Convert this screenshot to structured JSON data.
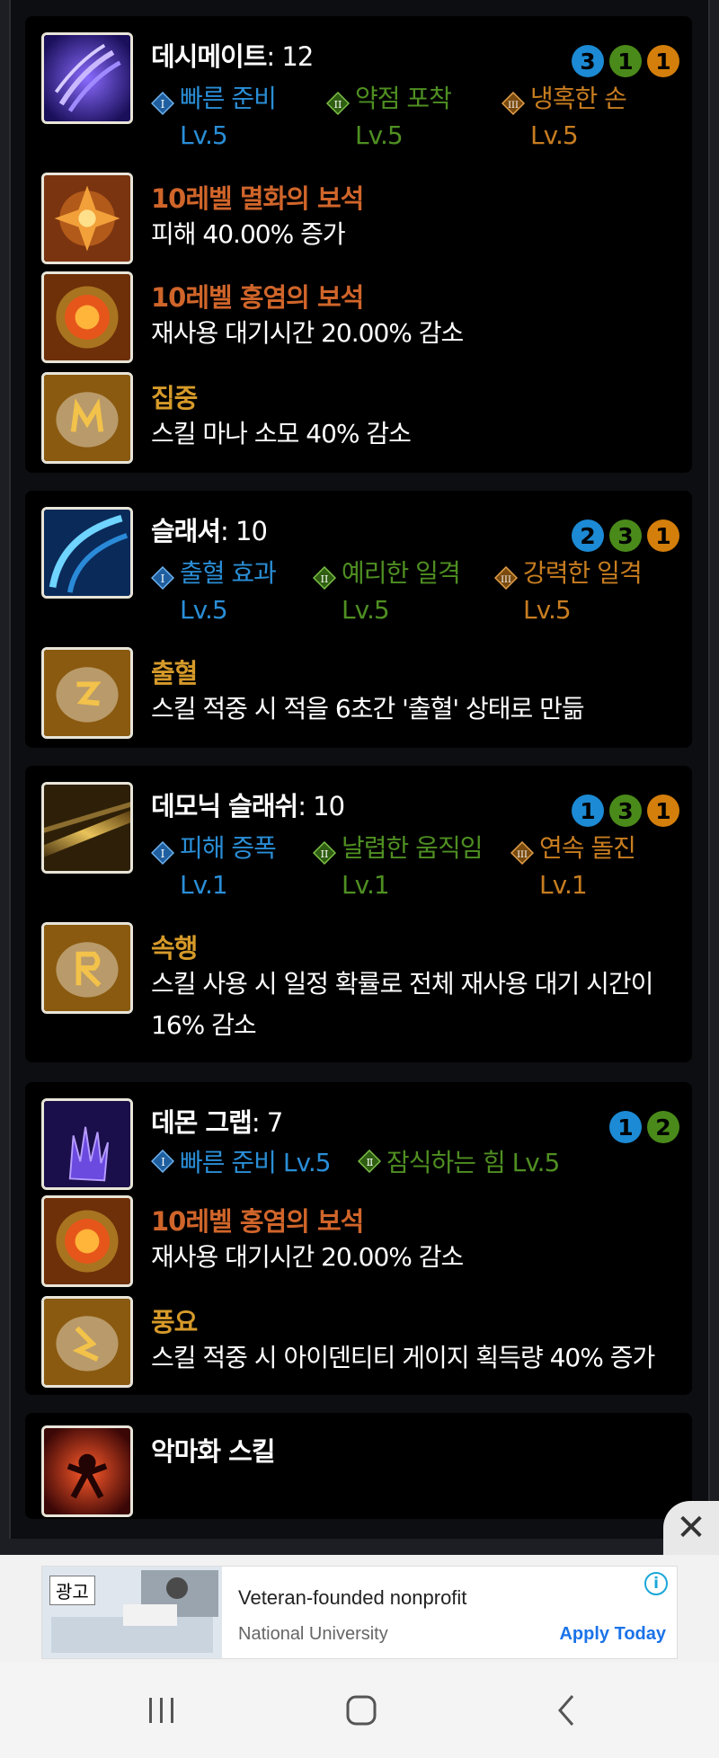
{
  "skills": [
    {
      "name": "데시메이트",
      "level": ": 12",
      "dots": [
        "3",
        "1",
        "1"
      ],
      "tripods": [
        {
          "name": "빠른 준비",
          "lv": "Lv.5"
        },
        {
          "name": "약점 포착",
          "lv": "Lv.5"
        },
        {
          "name": "냉혹한 손",
          "lv": "Lv.5"
        }
      ],
      "gems": [
        {
          "title": "10레벨 멸화의 보석",
          "desc": "피해 40.00% 증가"
        },
        {
          "title": "10레벨 홍염의 보석",
          "desc": "재사용 대기시간 20.00% 감소"
        }
      ],
      "rune": {
        "title": "집중",
        "desc": "스킬 마나 소모 40% 감소"
      }
    },
    {
      "name": "슬래셔",
      "level": ": 10",
      "dots": [
        "2",
        "3",
        "1"
      ],
      "tripods": [
        {
          "name": "출혈 효과",
          "lv": "Lv.5"
        },
        {
          "name": "예리한 일격",
          "lv": "Lv.5"
        },
        {
          "name": "강력한 일격",
          "lv": "Lv.5"
        }
      ],
      "rune": {
        "title": "출혈",
        "desc": "스킬 적중 시 적을 6초간 '출혈' 상태로 만듦"
      }
    },
    {
      "name": "데모닉 슬래쉬",
      "level": ": 10",
      "dots": [
        "1",
        "3",
        "1"
      ],
      "tripods": [
        {
          "name": "피해 증폭",
          "lv": "Lv.1"
        },
        {
          "name": "날렵한 움직임",
          "lv": "Lv.1"
        },
        {
          "name": "연속 돌진",
          "lv": "Lv.1"
        }
      ],
      "rune": {
        "title": "속행",
        "desc_line1": "스킬 사용 시 일정 확률로 전체 재사용 대기 시간이",
        "desc_line2": "16% 감소"
      }
    },
    {
      "name": "데몬 그랩",
      "level": ": 7",
      "dots": [
        "1",
        "2"
      ],
      "tripods": [
        {
          "name": "빠른 준비 Lv.5"
        },
        {
          "name": "잠식하는 힘 Lv.5"
        }
      ],
      "gems": [
        {
          "title": "10레벨 홍염의 보석",
          "desc": "재사용 대기시간 20.00% 감소"
        }
      ],
      "rune": {
        "title": "풍요",
        "desc": "스킬 적중 시 아이덴티티 게이지 획득량 40% 증가"
      }
    },
    {
      "name": "악마화 스킬"
    }
  ],
  "ad": {
    "badge": "광고",
    "title": "Veteran-founded nonprofit",
    "sponsor": "National University",
    "cta": "Apply Today",
    "info_glyph": "i"
  },
  "close_glyph": "✕",
  "colors": {
    "tripod_1": "#2a8ed6",
    "tripod_2": "#4f8f22",
    "tripod_3": "#c77d20",
    "gem_red": "#d0652a",
    "rune": "#d69a2a"
  }
}
